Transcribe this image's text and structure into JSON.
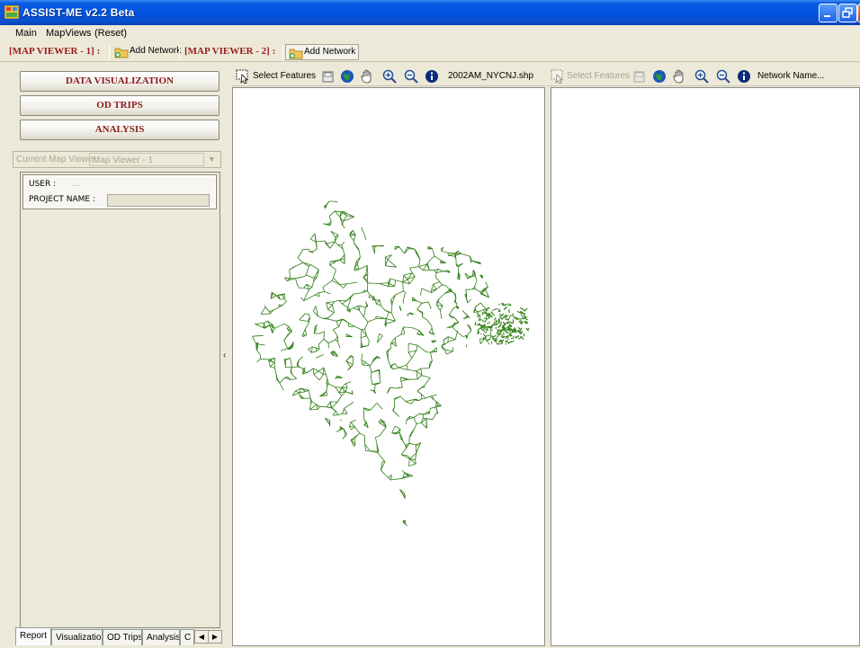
{
  "window": {
    "title": "ASSIST-ME v2.2 Beta",
    "controls": [
      "minimize",
      "restore",
      "close"
    ]
  },
  "menu": {
    "items": [
      "Main",
      "MapViews",
      "(Reset)"
    ]
  },
  "toolstrip": {
    "viewer1_label": "[MAP VIEWER - 1] :",
    "viewer1_add": "Add Network",
    "viewer2_label": "[MAP VIEWER - 2] :",
    "viewer2_add": "Add Network"
  },
  "left_panel": {
    "buttons": [
      "DATA VISUALIZATION",
      "OD TRIPS",
      "ANALYSIS"
    ],
    "current_viewer_label": "Current Map Viewer:",
    "current_viewer_value": "Map Viewer - 1",
    "user_label": "USER :",
    "user_value": "...",
    "project_label": "PROJECT NAME :",
    "project_value": "",
    "tabs": [
      "Report",
      "Visualization",
      "OD Trips",
      "Analysis",
      "C"
    ]
  },
  "viewer1": {
    "select_label": "Select Features",
    "network_name": "2002AM_NYCNJ.shp",
    "tools": [
      "save-icon",
      "globe-icon",
      "pan-hand-icon",
      "zoom-in-icon",
      "zoom-out-icon",
      "info-icon"
    ]
  },
  "viewer2": {
    "select_label": "Select Features",
    "network_name": "Network Name...",
    "tools": [
      "save-icon",
      "globe-icon",
      "pan-hand-icon",
      "zoom-in-icon",
      "zoom-out-icon",
      "info-icon"
    ]
  },
  "colors": {
    "title_bar": "#0054e3",
    "accent_text": "#9b1b1b",
    "network_lines": "#2e7d14",
    "chrome": "#ece9d8"
  }
}
